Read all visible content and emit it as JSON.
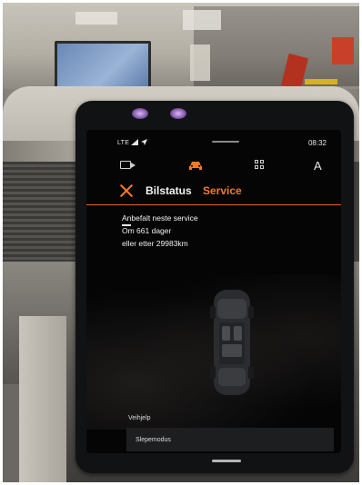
{
  "status_bar": {
    "signal_text": "LTE",
    "time": "08:32"
  },
  "topbar": {
    "icons": [
      "camera-icon",
      "car-icon",
      "apps-grid-icon"
    ],
    "profile_letter": "A",
    "active_icon_color": "#f07a2a"
  },
  "tabs": [
    {
      "label": "Bilstatus",
      "active": false
    },
    {
      "label": "Service",
      "active": true
    }
  ],
  "service": {
    "title": "Anbefalt neste service",
    "days_line": "Om 661 dager",
    "km_line": "eller etter 29983km"
  },
  "menu": {
    "section_label": "Veihjelp",
    "item": "Slepemodus"
  },
  "colors": {
    "accent": "#f07a2a",
    "screen_bg": "#050506"
  }
}
